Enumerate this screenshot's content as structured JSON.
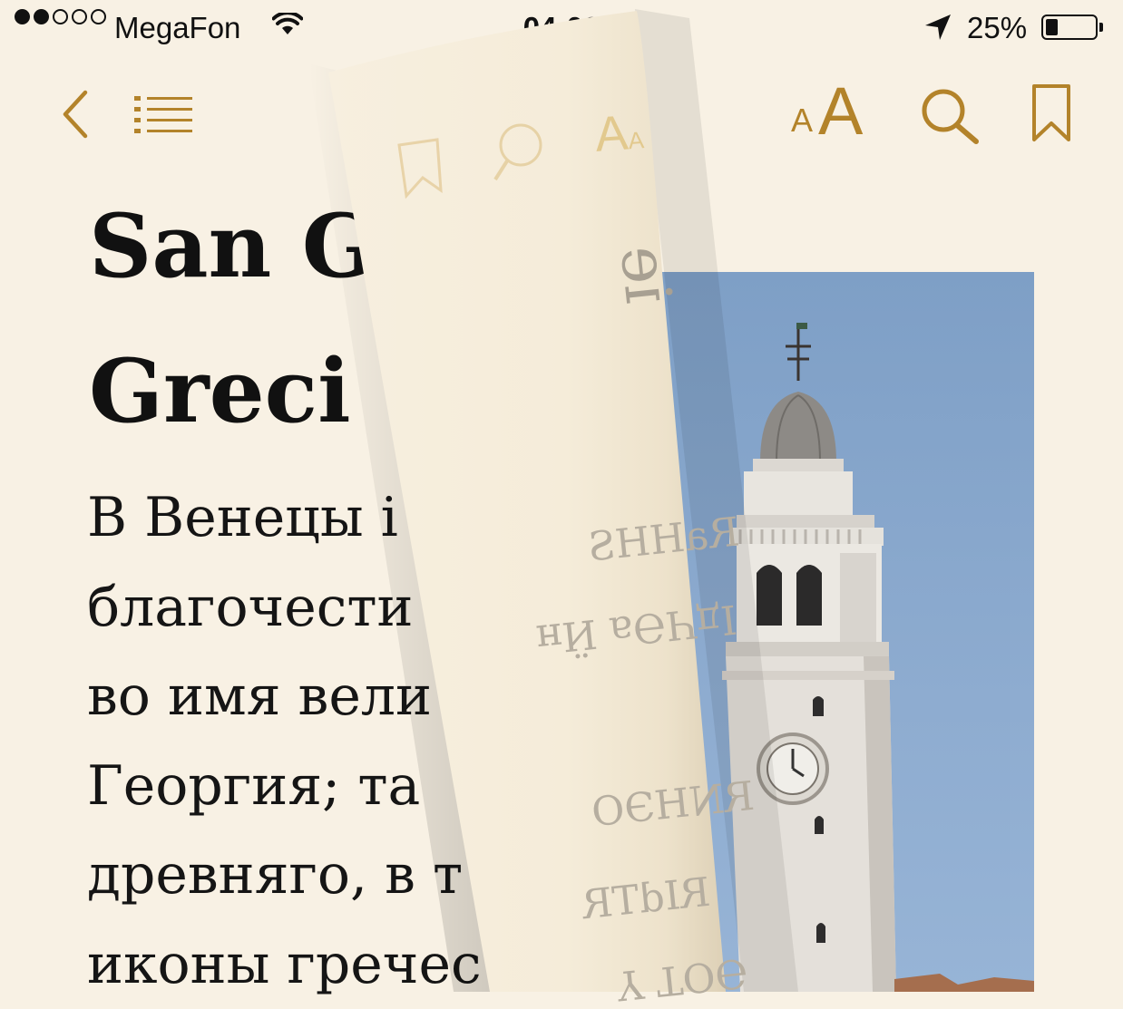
{
  "status_bar": {
    "carrier": "MegaFon",
    "time": "04:00",
    "battery_percent": "25%",
    "battery_level": 0.25,
    "signal_bars": 2,
    "signal_total": 5
  },
  "toolbar": {
    "font_small": "A",
    "font_large": "A",
    "icons": [
      "back-chevron-icon",
      "table-of-contents-icon",
      "font-size-icon",
      "search-icon",
      "bookmark-icon"
    ],
    "accent_color": "#b3832a"
  },
  "book": {
    "title_line1": "San G",
    "title_line2": "Greci",
    "lines": [
      "В Венецы і",
      "благочести",
      "во имя вели",
      "Георгия; та ",
      "древняго, в т",
      "иконы гречес"
    ]
  },
  "curl": {
    "back_text": [
      "ie",
      "RaHHS",
      "ІдЧӘа Ӥн",
      "RNHЭО",
      "RIdTR",
      "ӘОТ Ү"
    ],
    "back_font_small": "A",
    "back_font_large": "A"
  },
  "colors": {
    "paper": "#f8f1e4",
    "text": "#111111",
    "accent": "#b3832a"
  }
}
